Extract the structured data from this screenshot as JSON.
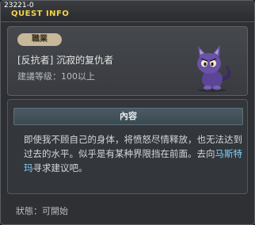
{
  "window": {
    "quest_id": "23221-0",
    "title": "QUEST INFO"
  },
  "header_panel": {
    "job_badge": "職業",
    "quest_name": "[反抗者] 沉寂的复仇者",
    "level_requirement": "建議等级：100以上"
  },
  "content_panel": {
    "heading": "內容",
    "text_part1": "即使我不顾自己的身体，将愤怒尽情释放，也无法达到过去的水平。似乎是有某种界限挡在前面。去向",
    "npc_name": "马斯特玛",
    "text_part2": "寻求建议吧。"
  },
  "status": {
    "text": "狀態：可開始"
  },
  "colors": {
    "title": "#f2d24a",
    "npc_link": "#7fd3ff",
    "badge": "#c8b89a"
  }
}
